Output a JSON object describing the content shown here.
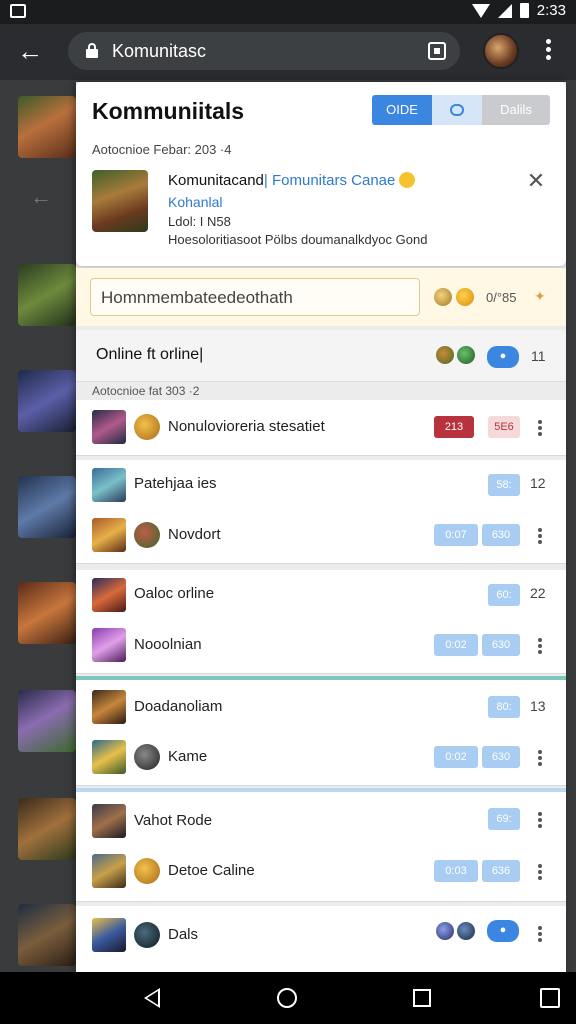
{
  "status_bar": {
    "time": "2:33"
  },
  "browser": {
    "url": "Komunitasc",
    "back_icon": "arrow-left-icon",
    "lock_icon": "lock-icon",
    "tabs_icon": "tabs-icon",
    "menu_icon": "more-vert-icon"
  },
  "panel": {
    "title": "Kommuniitals",
    "segments": [
      "OIDE",
      "",
      "Dalils"
    ],
    "meta": "Aotocnioe Febar: 203  ·4",
    "game": {
      "title_black": "Komunitacand",
      "title_blue": "| Fomunitars Canae",
      "subtitle": "Kohanlal",
      "code": "Ldol: I  N58",
      "description": "Hoesoloritiasoot Pölbs doumanalkdyoc Gond"
    }
  },
  "search": {
    "value": "Homnmembateedeothath",
    "count": "0/°85"
  },
  "online": {
    "label": "Online ft orline|",
    "count": "11"
  },
  "sub_meta": "Aotocnioe fat  303 ·2",
  "rows": [
    {
      "title": "Nonulovioreria stesatiet",
      "pill1": "213",
      "pill2": "5E6"
    },
    {
      "title": "Patehjaa ies",
      "count": "12",
      "pill_top": "58:",
      "pill1": "0:07",
      "pill2": "630"
    },
    {
      "title": "Novdort"
    },
    {
      "title": "Oaloc orline",
      "count": "22",
      "pill_top": "60:",
      "pill1": "0:02",
      "pill2": "630"
    },
    {
      "title": "Nooolnian"
    },
    {
      "title": "Doadanoliam",
      "count": "13",
      "pill_top": "80:",
      "pill1": "0:02",
      "pill2": "630"
    },
    {
      "title": "Kame"
    },
    {
      "title": "Vahot Rode",
      "pill_top": "69:"
    },
    {
      "title": "Detoe Caline",
      "pill1": "0:03",
      "pill2": "636"
    },
    {
      "title": "Dals"
    }
  ],
  "colors": {
    "accent": "#3a86e0",
    "pill_blue": "#a9ccf3",
    "pill_red": "#b7323d",
    "strip_bg": "#fff8e5"
  }
}
